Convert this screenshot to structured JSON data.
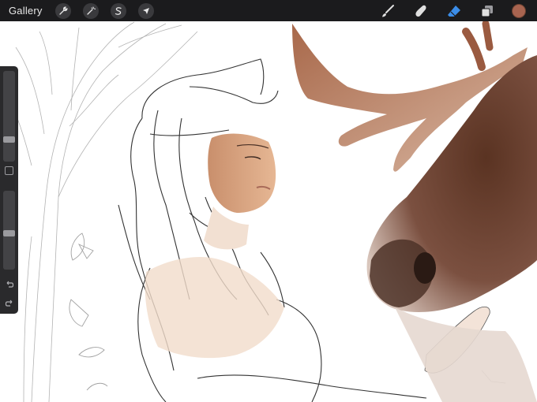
{
  "toolbar": {
    "gallery_label": "Gallery",
    "left_tools": [
      {
        "name": "actions",
        "icon": "wrench-icon"
      },
      {
        "name": "adjustments",
        "icon": "magic-wand-icon"
      },
      {
        "name": "selection",
        "icon": "selection-s-icon"
      },
      {
        "name": "transform",
        "icon": "arrow-cursor-icon"
      }
    ],
    "right_tools": [
      {
        "name": "brush",
        "icon": "brush-icon",
        "active": false
      },
      {
        "name": "smudge",
        "icon": "smudge-finger-icon",
        "active": false
      },
      {
        "name": "eraser",
        "icon": "eraser-icon",
        "active": true
      },
      {
        "name": "layers",
        "icon": "layers-icon",
        "active": false
      }
    ],
    "color": "#a86450",
    "active_color": "#3b8de8"
  },
  "sidebar": {
    "brush_size": 0.22,
    "opacity": 0.46,
    "undo_icon": "undo-icon",
    "redo_icon": "redo-icon",
    "modifier_icon": "square-modifier-icon"
  }
}
